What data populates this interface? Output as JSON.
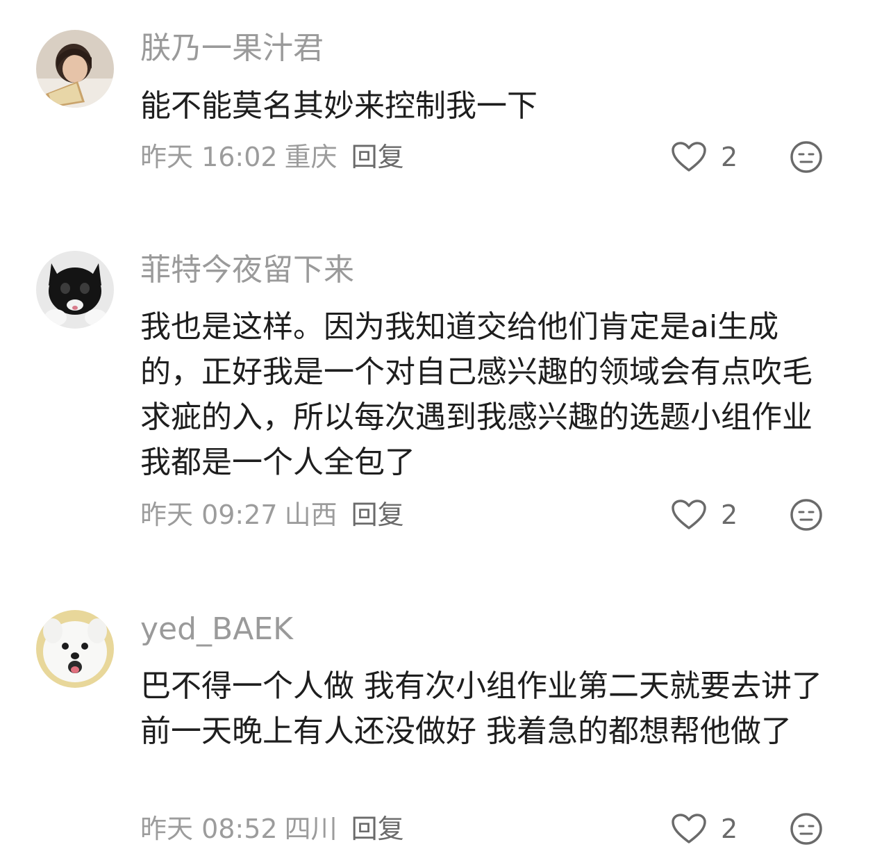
{
  "comments": [
    {
      "username": "朕乃一果汁君",
      "text": "能不能莫名其妙来控制我一下",
      "time": "昨天 16:02",
      "location": "重庆",
      "reply_label": "回复",
      "likes": "2",
      "avatar_icon": "avatar-girl-reading"
    },
    {
      "username": "菲特今夜留下来",
      "text": "我也是这样。因为我知道交给他们肯定是ai生成的，正好我是一个对自己感兴趣的领域会有点吹毛求疵的入，所以每次遇到我感兴趣的选题小组作业我都是一个人全包了",
      "time": "昨天 09:27",
      "location": "山西",
      "reply_label": "回复",
      "likes": "2",
      "avatar_icon": "avatar-black-cat"
    },
    {
      "username": "yed_BAEK",
      "text": "巴不得一个人做 我有次小组作业第二天就要去讲了 前一天晚上有人还没做好 我着急的都想帮他做了",
      "time": "昨天 08:52",
      "location": "四川",
      "reply_label": "回复",
      "likes": "2",
      "avatar_icon": "avatar-samoyed-dog"
    }
  ],
  "colors": {
    "username": "#9a9a9a",
    "body_text": "#1e1e1e",
    "meta": "#9c9c9c",
    "icon": "#6a6a6a"
  }
}
